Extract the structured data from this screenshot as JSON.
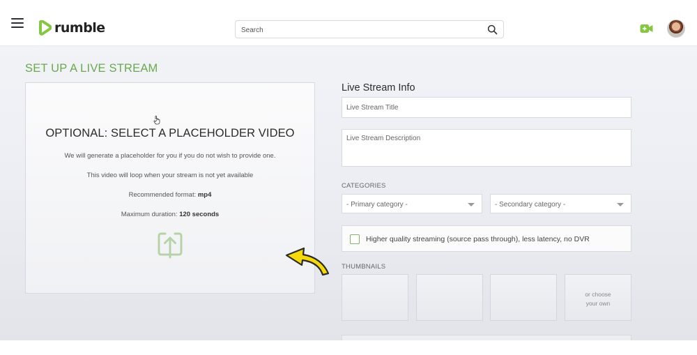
{
  "header": {
    "brand": "rumble",
    "search_placeholder": "Search",
    "menu_icon": "hamburger-menu-icon",
    "search_icon": "magnifier-icon",
    "go_live_icon": "video-camera-plus-icon",
    "avatar_icon": "user-avatar",
    "brand_color": "#85c742"
  },
  "page": {
    "title": "SET UP A LIVE STREAM",
    "title_color": "#6aa84f"
  },
  "placeholder_video": {
    "heading": "OPTIONAL: SELECT A PLACEHOLDER VIDEO",
    "line1": "We will generate a placeholder for you if you do not wish to provide one.",
    "line2": "This video will loop when your stream is not yet available",
    "format_label": "Recommended format:",
    "format_value": "mp4",
    "duration_label": "Maximum duration:",
    "duration_value": "120 seconds",
    "upload_icon": "upload-icon",
    "annotation_arrow": "yellow-curved-arrow",
    "annotation_color": "#f5d90a"
  },
  "form": {
    "section_title": "Live Stream Info",
    "title_placeholder": "Live Stream Title",
    "description_placeholder": "Live Stream Description",
    "categories_label": "CATEGORIES",
    "primary_category": "- Primary category -",
    "secondary_category": "- Secondary category -",
    "hq_label": "Higher quality streaming (source pass through), less latency, no DVR",
    "hq_checked": false,
    "thumbnails_label": "THUMBNAILS",
    "choose_own_line1": "or choose",
    "choose_own_line2": "your own"
  }
}
